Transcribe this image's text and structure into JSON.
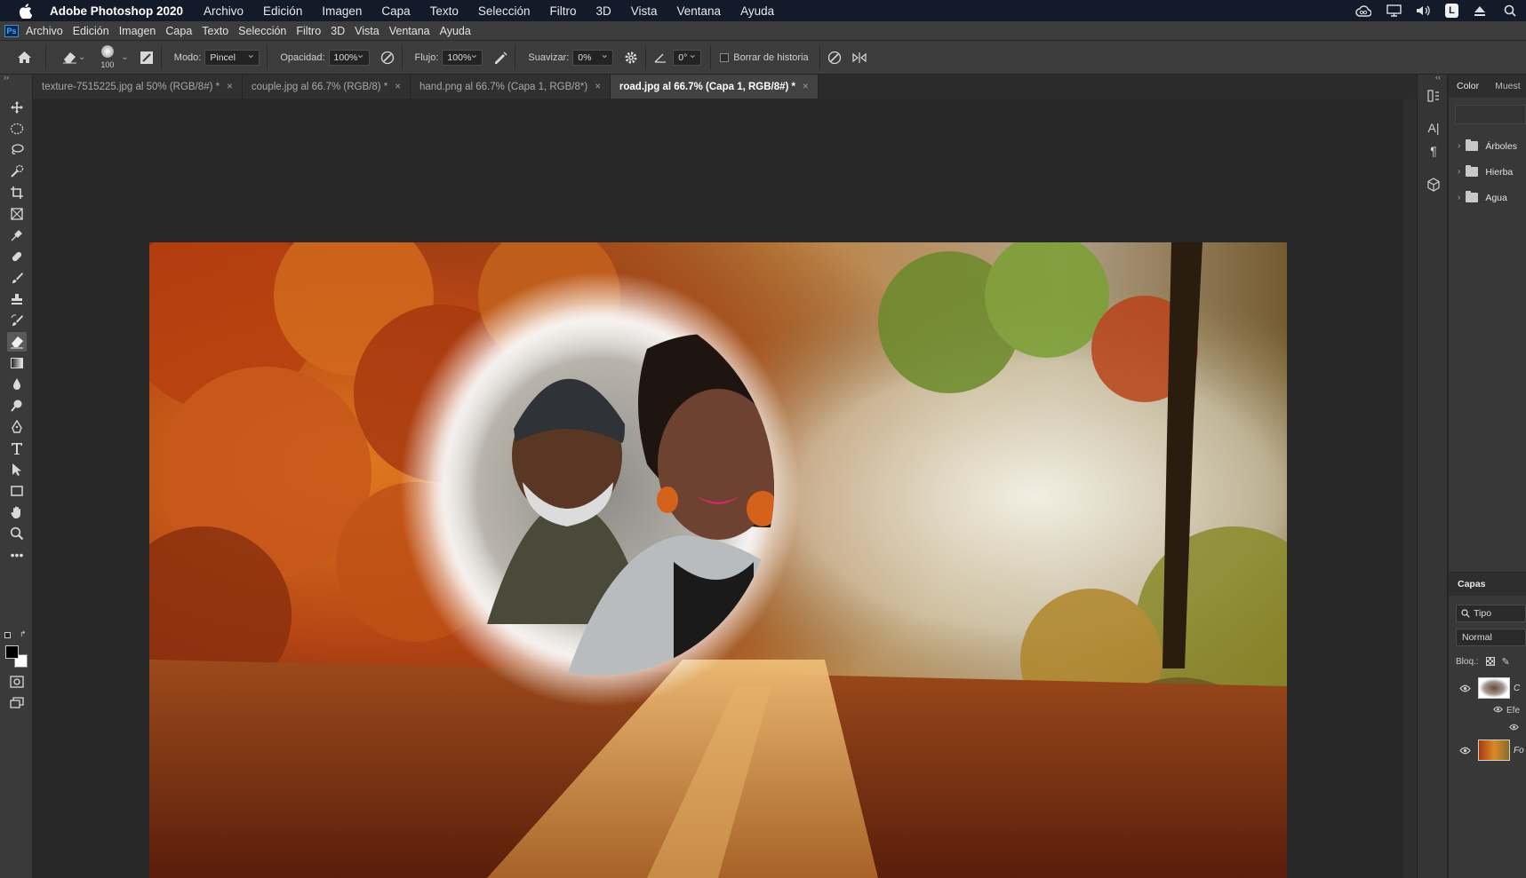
{
  "mac_menubar": {
    "app_name": "Adobe Photoshop 2020",
    "menus": [
      "Archivo",
      "Edición",
      "Imagen",
      "Capa",
      "Texto",
      "Selección",
      "Filtro",
      "3D",
      "Vista",
      "Ventana",
      "Ayuda"
    ],
    "status_icons": [
      "creative-cloud-icon",
      "display-icon",
      "volume-icon",
      "user-badge-icon",
      "eject-icon",
      "search-icon"
    ],
    "user_badge": "L"
  },
  "ps_menubar": {
    "logo": "Ps",
    "menus": [
      "Archivo",
      "Edición",
      "Imagen",
      "Capa",
      "Texto",
      "Selección",
      "Filtro",
      "3D",
      "Vista",
      "Ventana",
      "Ayuda"
    ]
  },
  "options_bar": {
    "brush_size": "100",
    "mode_label": "Modo:",
    "mode_value": "Pincel",
    "opacity_label": "Opacidad:",
    "opacity_value": "100%",
    "flow_label": "Flujo:",
    "flow_value": "100%",
    "smoothing_label": "Suavizar:",
    "smoothing_value": "0%",
    "angle_value": "0°",
    "erase_history_label": "Borrar de historia",
    "erase_history_checked": false
  },
  "tabs": [
    {
      "label": "texture-7515225.jpg al 50% (RGB/8#) *",
      "active": false
    },
    {
      "label": "couple.jpg al 66.7% (RGB/8) *",
      "active": false
    },
    {
      "label": "hand.png al 66.7% (Capa 1, RGB/8*)",
      "active": false
    },
    {
      "label": "road.jpg al 66.7% (Capa 1, RGB/8#) *",
      "active": true
    }
  ],
  "tab_close": "×",
  "tools": [
    "move-tool",
    "ellipse-marquee-tool",
    "lasso-tool",
    "quick-selection-tool",
    "crop-tool",
    "frame-tool",
    "eyedropper-tool",
    "healing-brush-tool",
    "brush-tool",
    "clone-stamp-tool",
    "history-brush-tool",
    "eraser-tool",
    "gradient-tool",
    "blur-tool",
    "dodge-tool",
    "pen-tool",
    "type-tool",
    "path-selection-tool",
    "rectangle-tool",
    "hand-tool",
    "zoom-tool",
    "more-tools",
    "swap-colors",
    "foreground-background-colors",
    "quick-mask",
    "screen-mode"
  ],
  "active_tool": "eraser-tool",
  "colors": {
    "foreground": "#000000",
    "background": "#ffffff",
    "accent": "#3a8fdc"
  },
  "right_panel": {
    "tabs": [
      "Color",
      "Muest"
    ],
    "groups": [
      "Árboles",
      "Hierba",
      "Agua"
    ]
  },
  "layers_panel": {
    "title": "Capas",
    "search_placeholder": "Tipo",
    "blend_mode": "Normal",
    "lock_label": "Bloq.:",
    "layers": [
      {
        "name": "C",
        "visible": true,
        "effects_label": "Efe"
      },
      {
        "name": "Fo",
        "visible": true
      }
    ]
  }
}
